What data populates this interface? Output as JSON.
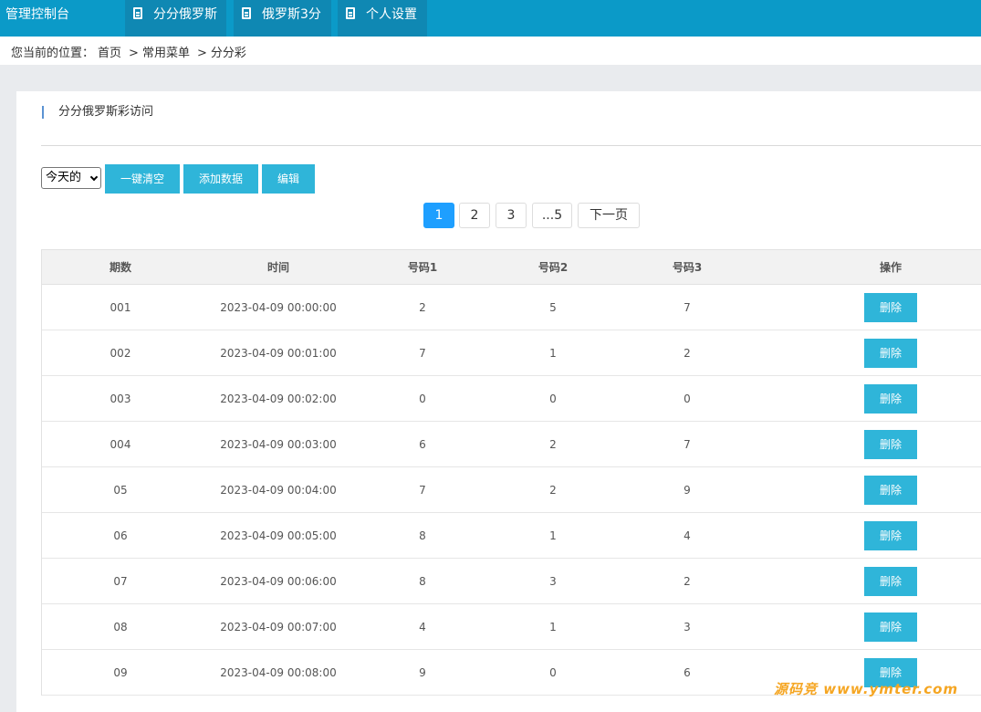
{
  "header": {
    "brand": "管理控制台",
    "nav": [
      {
        "label": "分分俄罗斯",
        "icon": "document-icon"
      },
      {
        "label": "俄罗斯3分",
        "icon": "document-icon"
      },
      {
        "label": "个人设置",
        "icon": "document-icon"
      }
    ]
  },
  "breadcrumb": {
    "prefix": "您当前的位置：",
    "items": [
      "首页",
      "常用菜单",
      "分分彩"
    ],
    "separator": ">"
  },
  "section": {
    "title": "分分俄罗斯彩访问"
  },
  "toolbar": {
    "date_select": "今天的",
    "clear_label": "一键清空",
    "add_label": "添加数据",
    "edit_label": "编辑"
  },
  "pagination": {
    "pages": [
      "1",
      "2",
      "3",
      "...5"
    ],
    "current": "1",
    "next_label": "下一页"
  },
  "table": {
    "headers": [
      "期数",
      "时间",
      "号码1",
      "号码2",
      "号码3",
      "操作"
    ],
    "delete_label": "删除",
    "rows": [
      {
        "period": "001",
        "time": "2023-04-09 00:00:00",
        "n1": "2",
        "n2": "5",
        "n3": "7"
      },
      {
        "period": "002",
        "time": "2023-04-09 00:01:00",
        "n1": "7",
        "n2": "1",
        "n3": "2"
      },
      {
        "period": "003",
        "time": "2023-04-09 00:02:00",
        "n1": "0",
        "n2": "0",
        "n3": "0"
      },
      {
        "period": "004",
        "time": "2023-04-09 00:03:00",
        "n1": "6",
        "n2": "2",
        "n3": "7"
      },
      {
        "period": "05",
        "time": "2023-04-09 00:04:00",
        "n1": "7",
        "n2": "2",
        "n3": "9"
      },
      {
        "period": "06",
        "time": "2023-04-09 00:05:00",
        "n1": "8",
        "n2": "1",
        "n3": "4"
      },
      {
        "period": "07",
        "time": "2023-04-09 00:06:00",
        "n1": "8",
        "n2": "3",
        "n3": "2"
      },
      {
        "period": "08",
        "time": "2023-04-09 00:07:00",
        "n1": "4",
        "n2": "1",
        "n3": "3"
      },
      {
        "period": "09",
        "time": "2023-04-09 00:08:00",
        "n1": "9",
        "n2": "0",
        "n3": "6"
      }
    ]
  },
  "watermark": "源码竞 www.ymter.com",
  "colors": {
    "header": "#0b9ac8",
    "nav_active": "#0f88b3",
    "button": "#2fb5d9",
    "pager_active": "#1e9fff"
  }
}
